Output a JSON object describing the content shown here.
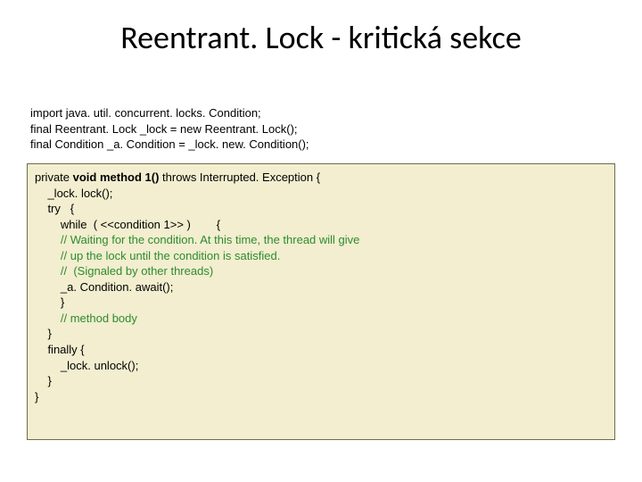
{
  "title": "Reentrant. Lock - kritická sekce",
  "intro": {
    "l1": "import java. util. concurrent. locks. Condition;",
    "l2": "final Reentrant. Lock _lock = new Reentrant. Lock();",
    "l3": "final Condition _a. Condition = _lock. new. Condition();"
  },
  "code": {
    "l1a": "private ",
    "l1b": "void method 1()",
    "l1c": " throws Interrupted. Exception {",
    "l2": "    _lock. lock();",
    "l3": "    try   {",
    "l4": "        while  ( <<condition 1>> )        {",
    "l5": "        // Waiting for the condition. At this time, the thread will give",
    "l6": "        // up the lock until the condition is satisfied.",
    "l7": "        //  (Signaled by other threads)",
    "l8": "        _a. Condition. await();",
    "l9": "        }",
    "l10": "        // method body",
    "l11": "    }",
    "l12": "    finally {",
    "l13": "        _lock. unlock();",
    "l14": "    }",
    "l15": "}"
  }
}
